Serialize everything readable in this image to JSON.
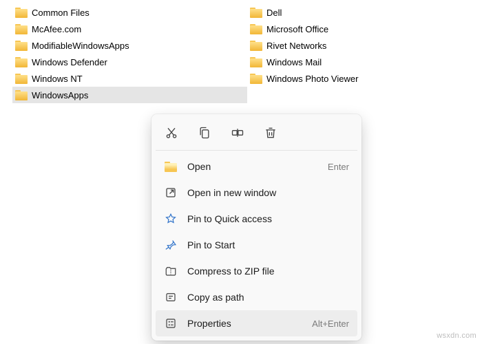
{
  "folders": {
    "left": [
      {
        "label": "Common Files"
      },
      {
        "label": "McAfee.com"
      },
      {
        "label": "ModifiableWindowsApps"
      },
      {
        "label": "Windows Defender"
      },
      {
        "label": "Windows NT"
      },
      {
        "label": "WindowsApps"
      }
    ],
    "right": [
      {
        "label": "Dell"
      },
      {
        "label": "Microsoft Office"
      },
      {
        "label": "Rivet Networks"
      },
      {
        "label": "Windows Mail"
      },
      {
        "label": "Windows Photo Viewer"
      }
    ]
  },
  "contextMenu": {
    "items": [
      {
        "label": "Open",
        "shortcut": "Enter"
      },
      {
        "label": "Open in new window",
        "shortcut": ""
      },
      {
        "label": "Pin to Quick access",
        "shortcut": ""
      },
      {
        "label": "Pin to Start",
        "shortcut": ""
      },
      {
        "label": "Compress to ZIP file",
        "shortcut": ""
      },
      {
        "label": "Copy as path",
        "shortcut": ""
      },
      {
        "label": "Properties",
        "shortcut": "Alt+Enter"
      }
    ]
  },
  "watermark": "wsxdn.com"
}
